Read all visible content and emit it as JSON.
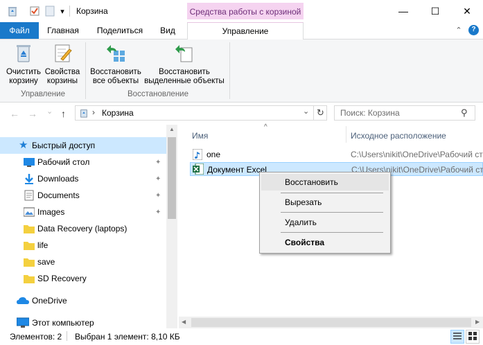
{
  "window": {
    "title": "Корзина",
    "contextual_tab_group": "Средства работы с корзиной",
    "minimize_glyph": "—",
    "maximize_glyph": "☐",
    "close_glyph": "✕",
    "qa_dropdown_glyph": "▾"
  },
  "ribbon_tabs": {
    "file": "Файл",
    "home": "Главная",
    "share": "Поделиться",
    "view": "Вид",
    "manage": "Управление",
    "collapse_glyph": "⌃",
    "help_glyph": "?"
  },
  "ribbon": {
    "empty_bin_line1": "Очистить",
    "empty_bin_line2": "корзину",
    "bin_props_line1": "Свойства",
    "bin_props_line2": "корзины",
    "group_manage": "Управление",
    "restore_all_line1": "Восстановить",
    "restore_all_line2": "все объекты",
    "restore_sel_line1": "Восстановить",
    "restore_sel_line2": "выделенные объекты",
    "group_restore": "Восстановление"
  },
  "navigation": {
    "back_glyph": "←",
    "forward_glyph": "→",
    "recent_glyph": "⌄",
    "up_glyph": "↑",
    "breadcrumb_sep": "›",
    "address": "Корзина",
    "dropdown_glyph": "⌄",
    "refresh_glyph": "↻",
    "search_placeholder": "Поиск: Корзина",
    "search_glyph": "⚲"
  },
  "nav_pane": {
    "quick_access": "Быстрый доступ",
    "pin_glyph": "📌",
    "items": [
      {
        "label": "Рабочий стол",
        "pinned": true
      },
      {
        "label": "Downloads",
        "pinned": true
      },
      {
        "label": "Documents",
        "pinned": true
      },
      {
        "label": "Images",
        "pinned": true
      },
      {
        "label": "Data Recovery (laptops)",
        "pinned": false
      },
      {
        "label": "life",
        "pinned": false
      },
      {
        "label": "save",
        "pinned": false
      },
      {
        "label": "SD Recovery",
        "pinned": false
      }
    ],
    "onedrive": "OneDrive",
    "this_pc": "Этот компьютер"
  },
  "content": {
    "col_name": "Имя",
    "col_location": "Исходное расположение",
    "sort_glyph": "^",
    "rows": [
      {
        "name": "one",
        "location": "C:\\Users\\nikit\\OneDrive\\Рабочий стол"
      },
      {
        "name": "Документ Excel",
        "location": "C:\\Users\\nikit\\OneDrive\\Рабочий стол"
      }
    ]
  },
  "context_menu": {
    "restore": "Восстановить",
    "cut": "Вырезать",
    "delete": "Удалить",
    "properties": "Свойства"
  },
  "status_bar": {
    "items": "Элементов: 2",
    "selected": "Выбран 1 элемент: 8,10 КБ"
  },
  "colors": {
    "file_tab": "#1979ca",
    "contextual_tab": "#f5d3f0",
    "selection": "#cce8ff",
    "folder": "#f4d03f",
    "restore_arrow": "#2e9b4b"
  }
}
